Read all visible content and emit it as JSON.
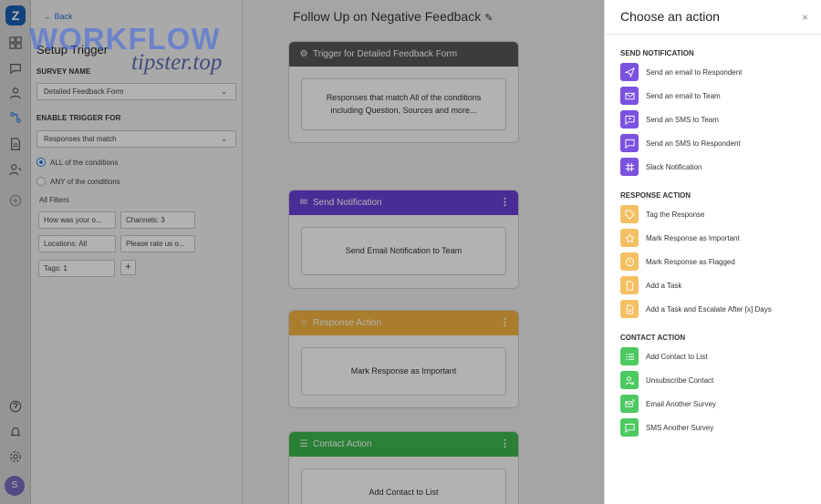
{
  "watermark": {
    "line1": "WORKFLOW",
    "line2": "tipster.top"
  },
  "rail": {
    "logo_letter": "Z",
    "avatar_letter": "S"
  },
  "setup": {
    "back_label": "Back",
    "title": "Setup Trigger",
    "survey_name_label": "SURVEY NAME",
    "survey_name_value": "Detailed Feedback Form",
    "enable_label": "ENABLE TRIGGER FOR",
    "enable_value": "Responses that match",
    "radio_all": "ALL of the conditions",
    "radio_any": "ANY of the conditions",
    "all_filters_label": "All Filters",
    "filters": [
      {
        "label": "How was your o..."
      },
      {
        "label": "Channels: 3"
      },
      {
        "label": "Locations: All"
      },
      {
        "label": "Please rate us o..."
      },
      {
        "label": "Tags: 1"
      }
    ],
    "add_filter_label": "+"
  },
  "canvas": {
    "title": "Follow Up on Negative Feedback",
    "cards": [
      {
        "header": "Trigger for Detailed Feedback Form",
        "body": "Responses that match All of the conditions including Question, Sources and more...",
        "color": "#575757"
      },
      {
        "header": "Send Notification",
        "body": "Send Email Notification to Team",
        "color": "#6a3fd8"
      },
      {
        "header": "Response Action",
        "body": "Mark Response as Important",
        "color": "#f3b340"
      },
      {
        "header": "Contact Action",
        "body": "Add Contact to List",
        "color": "#3db84d"
      }
    ]
  },
  "panel": {
    "title": "Choose an action",
    "close_label": "×",
    "sections": [
      {
        "title": "SEND NOTIFICATION",
        "color": "#7b52e0",
        "items": [
          {
            "label": "Send an email to Respondent",
            "icon": "send-icon"
          },
          {
            "label": "Send an email to Team",
            "icon": "mail-icon"
          },
          {
            "label": "Send an SMS to Team",
            "icon": "chat-team-icon"
          },
          {
            "label": "Send an SMS to Respondent",
            "icon": "chat-icon"
          },
          {
            "label": "Slack Notification",
            "icon": "slack-icon"
          }
        ]
      },
      {
        "title": "RESPONSE ACTION",
        "color": "#f4c063",
        "items": [
          {
            "label": "Tag the Response",
            "icon": "tag-icon"
          },
          {
            "label": "Mark Response as Important",
            "icon": "star-icon"
          },
          {
            "label": "Mark Response as Flagged",
            "icon": "flag-icon"
          },
          {
            "label": "Add a Task",
            "icon": "task-icon"
          },
          {
            "label": "Add a Task and Escalate After [x] Days",
            "icon": "escalate-icon"
          }
        ]
      },
      {
        "title": "CONTACT ACTION",
        "color": "#4cc960",
        "items": [
          {
            "label": "Add Contact to List",
            "icon": "list-icon"
          },
          {
            "label": "Unsubscribe Contact",
            "icon": "unsubscribe-icon"
          },
          {
            "label": "Email Another Survey",
            "icon": "email-survey-icon"
          },
          {
            "label": "SMS Another Survey",
            "icon": "sms-survey-icon"
          }
        ]
      }
    ]
  }
}
